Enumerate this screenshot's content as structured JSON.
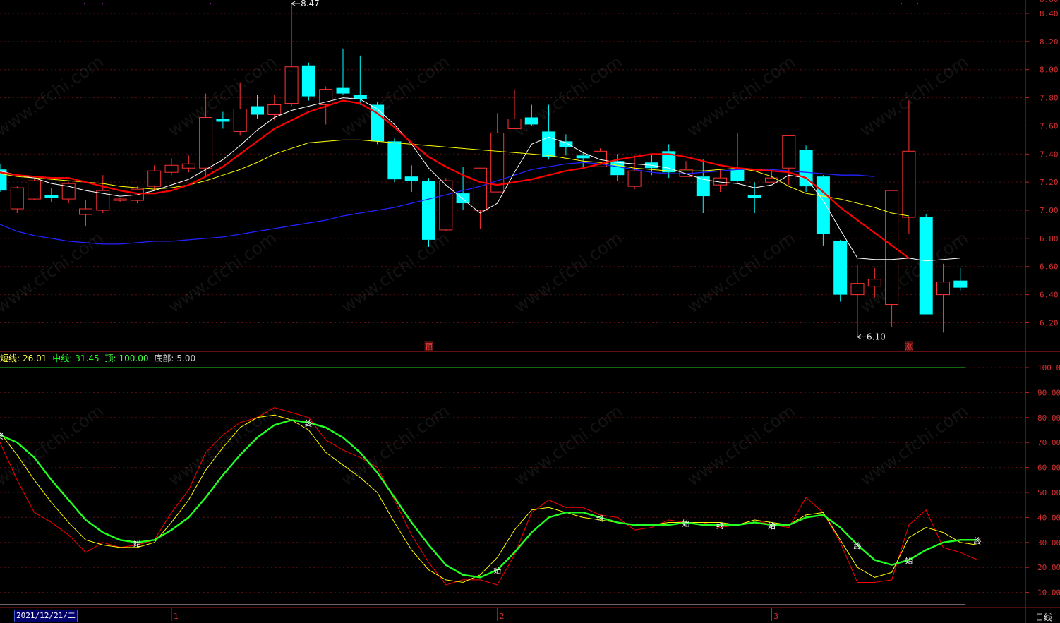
{
  "chart_data": [
    {
      "type": "candlestick",
      "ylim": [
        6.05,
        8.52
      ],
      "y_ticks": [
        "8.40",
        "8.20",
        "8.00",
        "7.80",
        "7.60",
        "7.40",
        "7.20",
        "7.00",
        "6.80",
        "6.60",
        "6.40",
        "6.20"
      ],
      "top_right_partial": "8.60",
      "candles": [
        [
          7.29,
          7.14,
          7.33,
          7.13
        ],
        [
          7.01,
          7.16,
          7.17,
          6.98
        ],
        [
          7.08,
          7.21,
          7.22,
          7.07
        ],
        [
          7.11,
          7.09,
          7.16,
          7.06
        ],
        [
          7.08,
          7.19,
          7.2,
          7.05
        ],
        [
          6.97,
          7.01,
          7.07,
          6.89
        ],
        [
          7.0,
          7.14,
          7.25,
          6.98
        ],
        [
          7.07,
          7.08,
          7.09,
          7.06
        ],
        [
          7.07,
          7.15,
          7.17,
          7.05
        ],
        [
          7.17,
          7.28,
          7.32,
          7.14
        ],
        [
          7.27,
          7.32,
          7.37,
          7.25
        ],
        [
          7.3,
          7.33,
          7.39,
          7.27
        ],
        [
          7.3,
          7.66,
          7.83,
          7.24
        ],
        [
          7.65,
          7.63,
          7.7,
          7.58
        ],
        [
          7.56,
          7.72,
          7.91,
          7.53
        ],
        [
          7.74,
          7.68,
          7.82,
          7.65
        ],
        [
          7.68,
          7.75,
          7.82,
          7.64
        ],
        [
          7.76,
          8.02,
          8.47,
          7.74
        ],
        [
          8.03,
          7.81,
          8.05,
          7.78
        ],
        [
          7.75,
          7.86,
          7.88,
          7.61
        ],
        [
          7.87,
          7.83,
          8.15,
          7.82
        ],
        [
          7.82,
          7.79,
          8.1,
          7.75
        ],
        [
          7.75,
          7.49,
          7.77,
          7.47
        ],
        [
          7.49,
          7.22,
          7.51,
          7.2
        ],
        [
          7.24,
          7.21,
          7.32,
          7.13
        ],
        [
          7.21,
          6.79,
          7.23,
          6.74
        ],
        [
          6.86,
          7.21,
          7.23,
          6.85
        ],
        [
          7.12,
          7.05,
          7.31,
          7.0
        ],
        [
          7.0,
          7.3,
          7.3,
          6.87
        ],
        [
          7.13,
          7.55,
          7.69,
          7.13
        ],
        [
          7.58,
          7.65,
          7.86,
          7.58
        ],
        [
          7.66,
          7.61,
          7.75,
          7.6
        ],
        [
          7.56,
          7.38,
          7.75,
          7.36
        ],
        [
          7.49,
          7.45,
          7.54,
          7.39
        ],
        [
          7.39,
          7.37,
          7.41,
          7.3
        ],
        [
          7.31,
          7.42,
          7.44,
          7.31
        ],
        [
          7.35,
          7.25,
          7.4,
          7.21
        ],
        [
          7.17,
          7.28,
          7.39,
          7.15
        ],
        [
          7.34,
          7.3,
          7.4,
          7.25
        ],
        [
          7.42,
          7.27,
          7.47,
          7.23
        ],
        [
          7.24,
          7.29,
          7.35,
          7.24
        ],
        [
          7.24,
          7.1,
          7.36,
          6.98
        ],
        [
          7.18,
          7.23,
          7.29,
          7.13
        ],
        [
          7.29,
          7.21,
          7.55,
          7.2
        ],
        [
          7.11,
          7.09,
          7.2,
          6.98
        ],
        [
          7.2,
          7.23,
          7.29,
          7.2
        ],
        [
          7.3,
          7.53,
          7.53,
          7.18
        ],
        [
          7.43,
          7.17,
          7.46,
          7.13
        ],
        [
          7.24,
          6.83,
          7.25,
          6.75
        ],
        [
          6.78,
          6.4,
          6.79,
          6.35
        ],
        [
          6.4,
          6.48,
          6.61,
          6.1
        ],
        [
          6.46,
          6.51,
          6.59,
          6.38
        ],
        [
          6.33,
          7.14,
          7.14,
          6.17
        ],
        [
          6.95,
          7.42,
          7.78,
          6.83
        ],
        [
          6.95,
          6.26,
          6.97,
          6.26
        ],
        [
          6.4,
          6.49,
          6.62,
          6.13
        ],
        [
          6.5,
          6.45,
          6.59,
          6.43
        ]
      ],
      "ma_short": [
        7.28,
        7.25,
        7.23,
        7.19,
        7.17,
        7.14,
        7.12,
        7.1,
        7.11,
        7.14,
        7.18,
        7.22,
        7.29,
        7.36,
        7.46,
        7.57,
        7.66,
        7.71,
        7.74,
        7.77,
        7.8,
        7.79,
        7.72,
        7.61,
        7.47,
        7.3,
        7.18,
        7.08,
        6.98,
        7.05,
        7.27,
        7.47,
        7.52,
        7.48,
        7.41,
        7.36,
        7.34,
        7.33,
        7.32,
        7.3,
        7.26,
        7.22,
        7.2,
        7.19,
        7.16,
        7.18,
        7.25,
        7.23,
        7.07,
        6.86,
        6.66,
        6.65,
        6.65,
        6.66,
        6.64,
        6.65,
        6.66
      ],
      "ma_mid": [
        7.27,
        7.25,
        7.24,
        7.23,
        7.23,
        7.2,
        7.17,
        7.14,
        7.12,
        7.12,
        7.14,
        7.18,
        7.24,
        7.31,
        7.4,
        7.49,
        7.58,
        7.64,
        7.7,
        7.74,
        7.78,
        7.76,
        7.69,
        7.59,
        7.48,
        7.38,
        7.31,
        7.25,
        7.2,
        7.18,
        7.2,
        7.22,
        7.25,
        7.28,
        7.3,
        7.33,
        7.36,
        7.38,
        7.4,
        7.4,
        7.38,
        7.35,
        7.32,
        7.3,
        7.29,
        7.28,
        7.27,
        7.23,
        7.13,
        7.02,
        6.93,
        6.84,
        6.75,
        6.66
      ],
      "ma_long": [
        7.26,
        7.24,
        7.23,
        7.22,
        7.21,
        7.2,
        7.19,
        7.17,
        7.16,
        7.15,
        7.16,
        7.18,
        7.21,
        7.25,
        7.29,
        7.34,
        7.4,
        7.44,
        7.48,
        7.49,
        7.5,
        7.5,
        7.49,
        7.48,
        7.47,
        7.46,
        7.45,
        7.44,
        7.43,
        7.42,
        7.41,
        7.4,
        7.39,
        7.37,
        7.35,
        7.34,
        7.32,
        7.3,
        7.29,
        7.28,
        7.28,
        7.28,
        7.29,
        7.3,
        7.28,
        7.24,
        7.17,
        7.12,
        7.1,
        7.08,
        7.05,
        7.02,
        6.98,
        6.96
      ],
      "ma_blue": [
        6.9,
        6.85,
        6.82,
        6.8,
        6.78,
        6.77,
        6.76,
        6.76,
        6.77,
        6.78,
        6.78,
        6.79,
        6.8,
        6.81,
        6.83,
        6.85,
        6.87,
        6.89,
        6.91,
        6.93,
        6.96,
        6.98,
        7.0,
        7.02,
        7.05,
        7.08,
        7.11,
        7.14,
        7.17,
        7.21,
        7.25,
        7.29,
        7.31,
        7.33,
        7.34,
        7.33,
        7.31,
        7.29,
        7.27,
        7.26,
        7.26,
        7.27,
        7.28,
        7.29,
        7.29,
        7.29,
        7.28,
        7.27,
        7.26,
        7.25,
        7.25,
        7.24
      ],
      "annotations": [
        {
          "text": "8.47",
          "bar": 17,
          "value": 8.47
        },
        {
          "text": "6.10",
          "bar": 50,
          "value": 6.1
        }
      ],
      "markers": [
        {
          "text": "预",
          "bar": 25
        },
        {
          "text": "涨",
          "bar": 53
        }
      ]
    },
    {
      "type": "line",
      "ylim": [
        5,
        103
      ],
      "y_ticks": [
        "100.00",
        "90.00",
        "80.00",
        "70.00",
        "60.00",
        "50.00",
        "40.00",
        "30.00",
        "20.00",
        "10.00"
      ],
      "level_line": 100,
      "red": [
        70,
        55,
        42,
        38,
        33,
        26,
        30,
        28,
        29,
        31,
        42,
        51,
        66,
        73,
        78,
        80,
        84,
        82,
        80,
        71,
        67,
        64,
        60,
        47,
        33,
        22,
        13,
        15,
        15,
        13,
        25,
        42,
        47,
        44,
        44,
        41,
        40,
        35,
        36,
        39,
        38,
        38,
        36,
        37,
        39,
        37,
        36,
        48,
        42,
        30,
        14,
        14,
        15,
        37,
        43,
        28,
        26,
        23
      ],
      "yellow": [
        74,
        65,
        55,
        46,
        38,
        31,
        29,
        28,
        28,
        30,
        38,
        47,
        59,
        68,
        76,
        80,
        81,
        79,
        75,
        66,
        61,
        56,
        50,
        38,
        27,
        19,
        15,
        14,
        17,
        24,
        35,
        43,
        44,
        42,
        40,
        39,
        38,
        37,
        37,
        38,
        38,
        38,
        38,
        37,
        39,
        38,
        37,
        41,
        42,
        31,
        20,
        16,
        18,
        32,
        36,
        34,
        30,
        29
      ],
      "green": [
        73,
        70,
        64,
        55,
        47,
        39,
        34,
        31,
        30,
        31,
        35,
        40,
        48,
        57,
        65,
        72,
        77,
        79,
        78,
        76,
        72,
        66,
        58,
        48,
        38,
        29,
        21,
        17,
        16,
        19,
        26,
        34,
        40,
        42,
        42,
        40,
        38,
        37,
        37,
        37,
        38,
        37,
        37,
        37,
        38,
        37,
        37,
        40,
        41,
        36,
        29,
        23,
        21,
        23,
        27,
        30,
        31,
        31
      ],
      "markers": [
        {
          "text": "终",
          "bar": 0
        },
        {
          "text": "始",
          "bar": 8
        },
        {
          "text": "终",
          "bar": 18
        },
        {
          "text": "始",
          "bar": 29
        },
        {
          "text": "终",
          "bar": 35
        },
        {
          "text": "始",
          "bar": 40
        },
        {
          "text": "终",
          "bar": 42
        },
        {
          "text": "始",
          "bar": 45
        },
        {
          "text": "终",
          "bar": 50
        },
        {
          "text": "始",
          "bar": 53
        },
        {
          "text": "终",
          "bar": 57
        }
      ]
    }
  ],
  "legend": {
    "short_label": "短线:",
    "short_value": "26.01",
    "mid_label": "中线:",
    "mid_value": "31.45",
    "top_label": "顶:",
    "top_value": "100.00",
    "bottom_label": "底部:",
    "bottom_value": "5.00"
  },
  "x_axis": {
    "start_date": "2021/12/21/二",
    "month_labels": [
      "1",
      "2",
      "3"
    ],
    "month_bars": [
      10,
      29,
      45
    ]
  },
  "period_label": "日线",
  "watermark": "www.cfchi.com",
  "colors": {
    "up": "#ff3232",
    "down": "#00ffff",
    "ma_short": "#ffffff",
    "ma_mid": "#ff0000",
    "ma_long": "#ffff00",
    "ma_blue": "#2222ff",
    "ind_red": "#ff0000",
    "ind_yellow": "#ffff00",
    "ind_green": "#22ff22",
    "axis": "#c02020",
    "grid": "#5a1010"
  }
}
